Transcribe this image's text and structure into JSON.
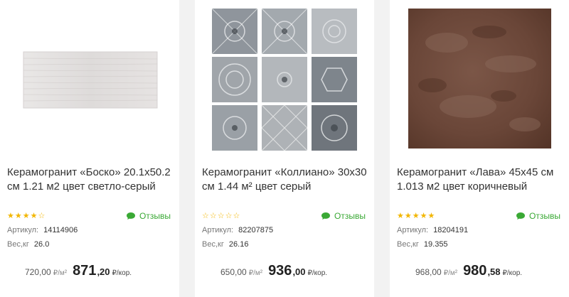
{
  "products": [
    {
      "title": "Керамогранит «Боско» 20.1x50.2 см 1.21 м2 цвет светло-серый",
      "stars": "★★★★☆",
      "reviews": "Отзывы",
      "article_label": "Артикул:",
      "article": "14114906",
      "weight_label": "Вес,кг",
      "weight": "26.0",
      "old_price": "720,00",
      "old_unit": "₽/м²",
      "price_int": "871",
      "price_frac": ",20",
      "price_unit": "₽/кор."
    },
    {
      "title": "Керамогранит «Коллиано» 30x30 см 1.44 м² цвет серый",
      "stars": "☆☆☆☆☆",
      "reviews": "Отзывы",
      "article_label": "Артикул:",
      "article": "82207875",
      "weight_label": "Вес,кг",
      "weight": "26.16",
      "old_price": "650,00",
      "old_unit": "₽/м²",
      "price_int": "936",
      "price_frac": ",00",
      "price_unit": "₽/кор."
    },
    {
      "title": "Керамогранит «Лава» 45x45 см 1.013 м2 цвет коричневый",
      "stars": "★★★★★",
      "reviews": "Отзывы",
      "article_label": "Артикул:",
      "article": "18204191",
      "weight_label": "Вес,кг",
      "weight": "19.355",
      "old_price": "968,00",
      "old_unit": "₽/м²",
      "price_int": "980",
      "price_frac": ",58",
      "price_unit": "₽/кор."
    }
  ],
  "colors": {
    "accent_green": "#3aa935",
    "star": "#f2b600",
    "lava_tile": "#6e4a3c"
  }
}
